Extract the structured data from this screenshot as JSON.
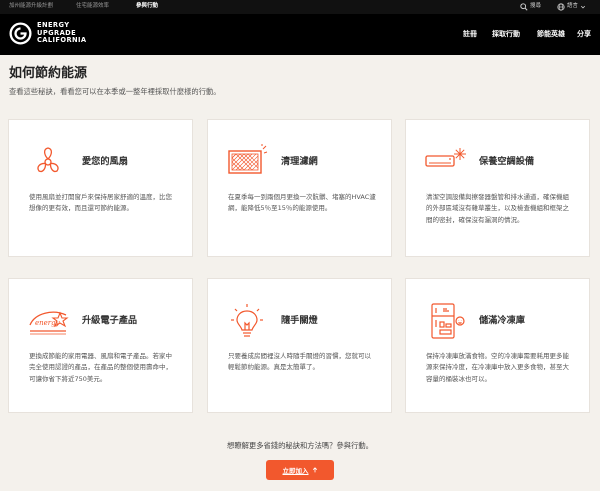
{
  "top_links": [
    "加州能源升級計劃",
    "住宅能源效率",
    "參與行動"
  ],
  "utility": {
    "search": "搜尋",
    "language": "語言"
  },
  "logo": {
    "line1": "ENERGY",
    "line2": "UPGRADE",
    "line3": "CALIFORNIA"
  },
  "main_nav": [
    "註冊",
    "採取行動",
    "節能英雄",
    "分享"
  ],
  "page": {
    "title": "如何節約能源",
    "subtitle": "查看這些秘訣，看看您可以在本季或一整年裡採取什麼樣的行動。"
  },
  "cards": [
    {
      "icon": "fan-icon",
      "title": "愛您的風扇",
      "desc": "使用風扇並打開窗戶來保持居家舒適的溫度，比您想像的更有效，而且還可節約能源。"
    },
    {
      "icon": "air-filter-icon",
      "title": "清理濾網",
      "desc": "在夏季每一到兩個月更換一次骯髒、堵塞的HVAC濾網，能降低5％至15％的能源使用。"
    },
    {
      "icon": "ac-unit-icon",
      "title": "保養空調設備",
      "desc": "清潔空調設備與擦發器盤管和排水通道，確保機組的外部區域沒有雜草叢生，以及檢查機組和框架之間的密封，確保沒有漏洞的情況。"
    },
    {
      "icon": "energy-star-icon",
      "title": "升級電子產品",
      "desc": "更換成節能的家用電器、風扇和電子產品。若家中完全使用認證的產品，在產品的整個使用壽命中，可讓你省下將近750美元。"
    },
    {
      "icon": "light-bulb-icon",
      "title": "隨手關燈",
      "desc": "只要養成房間裡沒人時隨手關燈的習慣，您就可以輕鬆節約能源。真是太簡單了。"
    },
    {
      "icon": "refrigerator-icon",
      "title": "儲滿冷凍庫",
      "desc": "保持冷凍庫放滿食物。空的冷凍庫需要耗用更多能源來保持冷度，在冷凍庫中放入更多食物，甚至大容量的桶裝冰也可以。"
    }
  ],
  "footer": {
    "question": "想瞭解更多省錢的秘訣和方法嗎？參與行動。",
    "cta": "立即加入",
    "cta_icon": "arrow-up-icon"
  },
  "colors": {
    "accent": "#f2582d",
    "header": "#000000",
    "background": "#f4f1ec"
  }
}
